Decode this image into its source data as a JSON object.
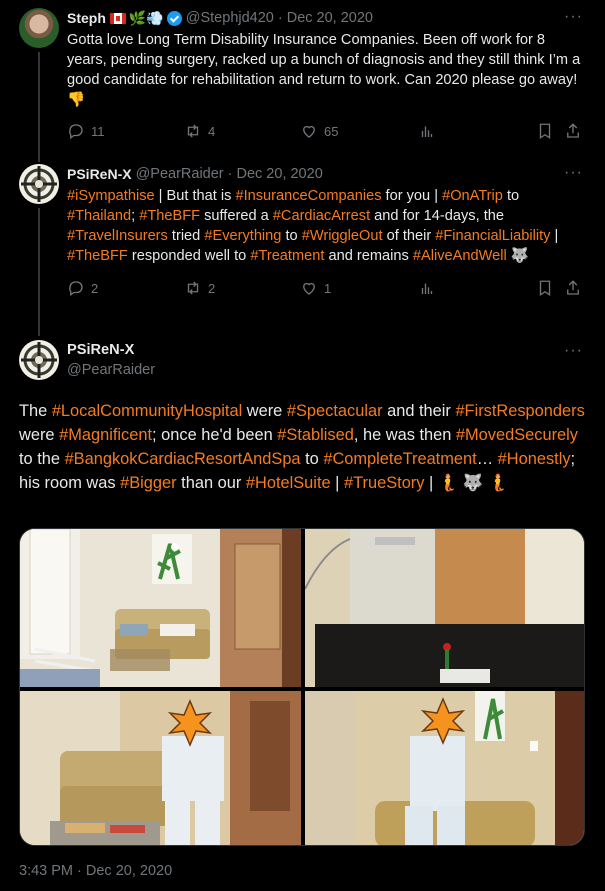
{
  "tweet1": {
    "name": "Steph",
    "name_emojis": [
      "canada-flag",
      "herb",
      "wind"
    ],
    "handle": "@Stephjd420",
    "date": "· Dec 20, 2020",
    "text": "Gotta love Long Term Disability Insurance Companies. Been off work for 8 years, pending surgery, racked up a bunch of diagnosis and they still think I’m a good candidate for rehabilitation and return to work. Can 2020 please go away! 👎",
    "replies": "11",
    "retweets": "4",
    "likes": "65"
  },
  "tweet2": {
    "name": "PSiReN-X",
    "handle": "@PearRaider",
    "date": "· Dec 20, 2020",
    "segments": [
      {
        "t": "#iSympathise",
        "tag": true
      },
      {
        "t": " | But that is ",
        "tag": false
      },
      {
        "t": "#InsuranceCompanies",
        "tag": true
      },
      {
        "t": " for you | ",
        "tag": false
      },
      {
        "t": "#OnATrip",
        "tag": true
      },
      {
        "t": " to ",
        "tag": false
      },
      {
        "t": "#Thailand",
        "tag": true
      },
      {
        "t": "; ",
        "tag": false
      },
      {
        "t": "#TheBFF",
        "tag": true
      },
      {
        "t": " suffered a ",
        "tag": false
      },
      {
        "t": "#CardiacArrest",
        "tag": true
      },
      {
        "t": " and for 14-days, the ",
        "tag": false
      },
      {
        "t": "#TravelInsurers",
        "tag": true
      },
      {
        "t": " tried ",
        "tag": false
      },
      {
        "t": "#Everything",
        "tag": true
      },
      {
        "t": " to ",
        "tag": false
      },
      {
        "t": "#WriggleOut",
        "tag": true
      },
      {
        "t": " of their ",
        "tag": false
      },
      {
        "t": "#FinancialLiability",
        "tag": true
      },
      {
        "t": " | ",
        "tag": false
      },
      {
        "t": "#TheBFF",
        "tag": true
      },
      {
        "t": " responded well to ",
        "tag": false
      },
      {
        "t": "#Treatment",
        "tag": true
      },
      {
        "t": " and remains ",
        "tag": false
      },
      {
        "t": "#AliveAndWell",
        "tag": true
      },
      {
        "t": " 🐺",
        "tag": false
      }
    ],
    "replies": "2",
    "retweets": "2",
    "likes": "1"
  },
  "tweet3": {
    "name": "PSiReN-X",
    "handle": "@PearRaider",
    "segments": [
      {
        "t": "The ",
        "tag": false
      },
      {
        "t": "#LocalCommunityHospital",
        "tag": true
      },
      {
        "t": " were ",
        "tag": false
      },
      {
        "t": "#Spectacular",
        "tag": true
      },
      {
        "t": " and their ",
        "tag": false
      },
      {
        "t": "#FirstResponders",
        "tag": true
      },
      {
        "t": " were ",
        "tag": false
      },
      {
        "t": "#Magnificent",
        "tag": true
      },
      {
        "t": "; once he'd been ",
        "tag": false
      },
      {
        "t": "#Stablised",
        "tag": true
      },
      {
        "t": ", he was then ",
        "tag": false
      },
      {
        "t": "#MovedSecurely",
        "tag": true
      },
      {
        "t": " to the ",
        "tag": false
      },
      {
        "t": "#BangkokCardiacResortAndSpa",
        "tag": true
      },
      {
        "t": " to ",
        "tag": false
      },
      {
        "t": "#CompleteTreatment",
        "tag": true
      },
      {
        "t": "… ",
        "tag": false
      },
      {
        "t": "#Honestly",
        "tag": true
      },
      {
        "t": "; his room was ",
        "tag": false
      },
      {
        "t": "#Bigger",
        "tag": true
      },
      {
        "t": " than our ",
        "tag": false
      },
      {
        "t": "#HotelSuite",
        "tag": true
      },
      {
        "t": " | ",
        "tag": false
      },
      {
        "t": "#TrueStory",
        "tag": true
      },
      {
        "t": " | 🧜 🐺 🧜",
        "tag": false
      }
    ],
    "timestamp": "3:43 PM · Dec 20, 2020"
  },
  "colors": {
    "hashtag": "#f47c20",
    "muted": "#71767b",
    "text": "#e7e9ea",
    "bg": "#000000"
  }
}
